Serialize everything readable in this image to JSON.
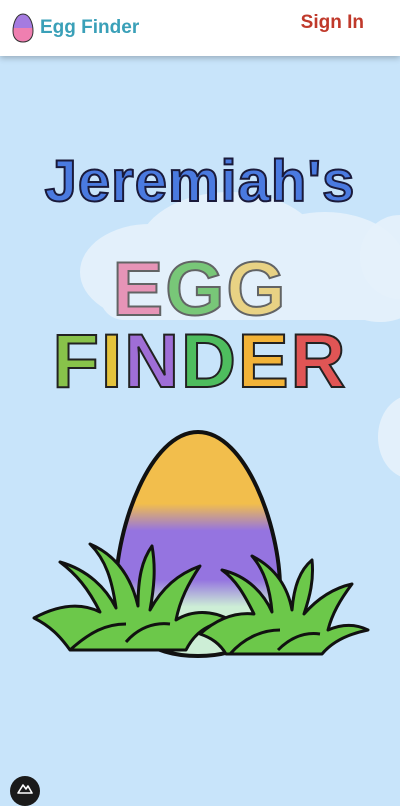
{
  "nav": {
    "brand_text": "Egg Finder",
    "signin_label": "Sign In"
  },
  "hero": {
    "line1": "Jeremiah's",
    "line2_letters": [
      "E",
      "G",
      "G"
    ],
    "line3_letters": [
      "F",
      "I",
      "N",
      "D",
      "E",
      "R"
    ]
  },
  "colors": {
    "sky": "#c8e4fa",
    "brand_text": "#3aa0b8",
    "signin": "#c0392b",
    "title_blue": "#4a7ae0",
    "egg_letters": [
      "#e78bb0",
      "#6dc36a",
      "#e9cf78"
    ],
    "finder_letters": [
      "#88c24a",
      "#e4c33c",
      "#9f6ed6",
      "#4ebd5e",
      "#f2b338",
      "#e05555"
    ],
    "egg_top": "#f2be4c",
    "egg_middle": "#9574e0",
    "egg_bottom": "#cdeed6",
    "grass": "#6cc84a"
  },
  "icons": {
    "brand_logo": "striped-egg-icon",
    "corner_badge": "mountain-icon"
  }
}
